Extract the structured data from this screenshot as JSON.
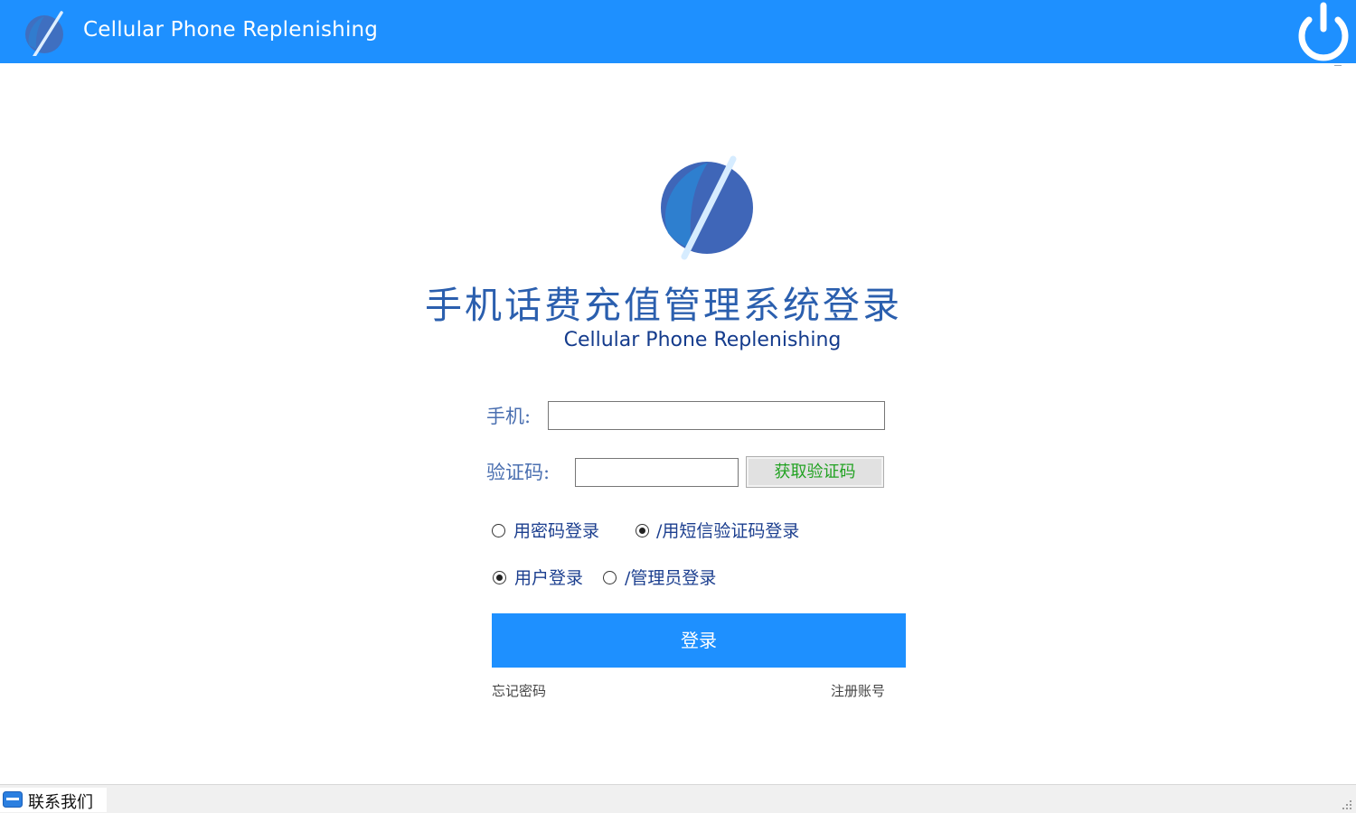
{
  "header": {
    "title": "Cellular Phone Replenishing",
    "logo_icon": "planet-logo-icon",
    "power_icon": "power-icon"
  },
  "brand": {
    "title": "手机话费充值管理系统登录",
    "subtitle": "Cellular Phone Replenishing"
  },
  "form": {
    "phone_label": "手机:",
    "phone_value": "",
    "code_label": "验证码:",
    "code_value": "",
    "get_code_button": "获取验证码",
    "method_options": [
      {
        "label": "用密码登录",
        "selected": false
      },
      {
        "label": "/用短信验证码登录",
        "selected": true
      }
    ],
    "role_options": [
      {
        "label": "用户登录",
        "selected": true
      },
      {
        "label": "/管理员登录",
        "selected": false
      }
    ],
    "login_button": "登录",
    "forgot_password": "忘记密码",
    "register": "注册账号"
  },
  "statusbar": {
    "contact_label": "联系我们",
    "contact_icon": "mail-icon"
  },
  "colors": {
    "accent": "#1e90ff",
    "title_text": "#2b5fae",
    "code_button_text": "#22a222"
  }
}
